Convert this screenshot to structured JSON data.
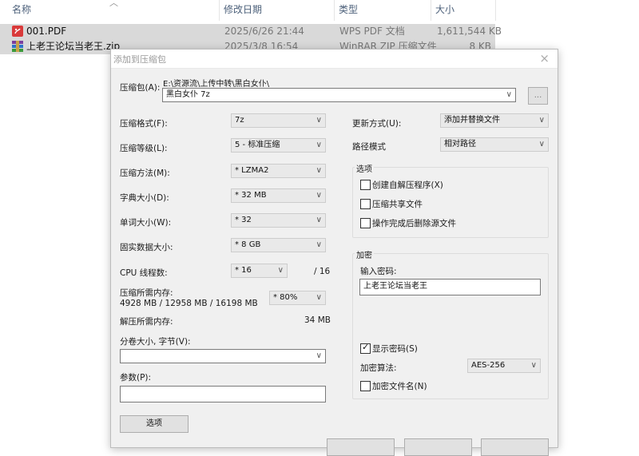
{
  "explorer": {
    "columns": {
      "name": "名称",
      "date": "修改日期",
      "type": "类型",
      "size": "大小"
    },
    "files": [
      {
        "name": "001.PDF",
        "date": "2025/6/26 21:44",
        "type": "WPS PDF 文档",
        "size": "1,611,544 KB",
        "icon": "pdf-icon"
      },
      {
        "name": "上老王论坛当老王.zip",
        "date": "2025/3/8 16:54",
        "type": "WinRAR ZIP 压缩文件",
        "size": "8 KB",
        "icon": "winrar-icon"
      }
    ]
  },
  "dialog": {
    "title": "添加到压缩包",
    "archive_label": "压缩包(A):",
    "archive_path": "E:\\资源流\\上传中转\\黑白女仆\\",
    "archive_name": "黑白女仆 7z",
    "browse_label": "...",
    "format_label": "压缩格式(F):",
    "format_value": "7z",
    "level_label": "压缩等级(L):",
    "level_value": "5 - 标准压缩",
    "method_label": "压缩方法(M):",
    "method_value": "* LZMA2",
    "dict_label": "字典大小(D):",
    "dict_value": "* 32 MB",
    "word_label": "单词大小(W):",
    "word_value": "* 32",
    "solid_label": "固实数据大小:",
    "solid_value": "* 8 GB",
    "cpu_label": "CPU 线程数:",
    "cpu_value": "* 16",
    "cpu_max": "/ 16",
    "mem_label": "压缩所需内存:",
    "mem_detail": "4928 MB / 12958 MB / 16198 MB",
    "mem_percent": "* 80%",
    "decomp_label": "解压所需内存:",
    "decomp_value": "34 MB",
    "split_label": "分卷大小, 字节(V):",
    "split_value": "",
    "params_label": "参数(P):",
    "params_value": "",
    "options_button": "选项",
    "update_label": "更新方式(U):",
    "update_value": "添加并替换文件",
    "path_label": "路径模式",
    "path_value": "相对路径",
    "options_group": "选项",
    "opt_sfx": "创建自解压程序(X)",
    "opt_shared": "压缩共享文件",
    "opt_delete": "操作完成后删除源文件",
    "encrypt_group": "加密",
    "password_label": "输入密码:",
    "password_value": "上老王论坛当老王",
    "show_password": "显示密码(S)",
    "encrypt_method_label": "加密算法:",
    "encrypt_method_value": "AES-256",
    "encrypt_names": "加密文件名(N)",
    "close_icon": "×",
    "chevron": "∨",
    "checkmark": "✓"
  }
}
